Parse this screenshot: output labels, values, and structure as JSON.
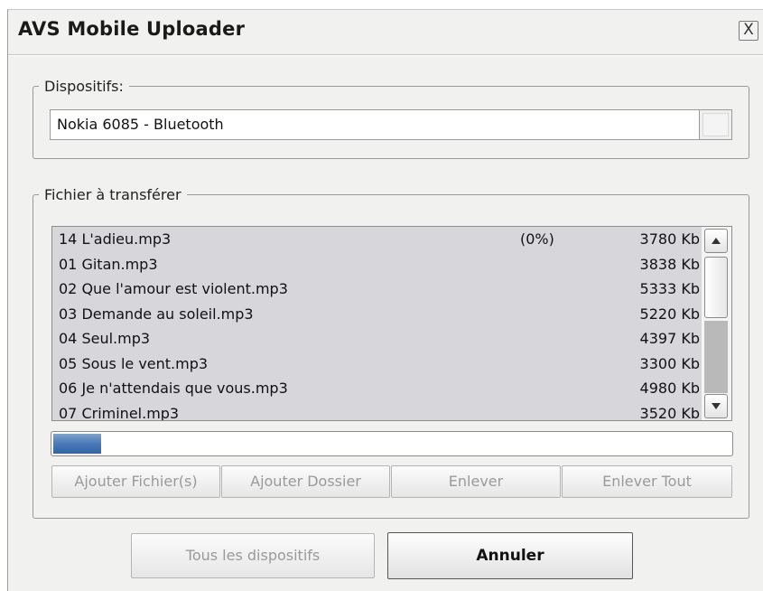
{
  "window": {
    "title": "AVS Mobile Uploader",
    "close_label": "X"
  },
  "devices": {
    "legend": "Dispositifs:",
    "selected": "Nokia 6085 - Bluetooth"
  },
  "files": {
    "legend": "Fichier à transférer",
    "rows": [
      {
        "name": "14 L'adieu.mp3",
        "pct": "(0%)",
        "size": "3780 Kb"
      },
      {
        "name": "01 Gitan.mp3",
        "pct": "",
        "size": "3838 Kb"
      },
      {
        "name": "02 Que l'amour est violent.mp3",
        "pct": "",
        "size": "5333 Kb"
      },
      {
        "name": "03 Demande au soleil.mp3",
        "pct": "",
        "size": "5220 Kb"
      },
      {
        "name": "04 Seul.mp3",
        "pct": "",
        "size": "4397 Kb"
      },
      {
        "name": "05 Sous le vent.mp3",
        "pct": "",
        "size": "3300 Kb"
      },
      {
        "name": "06 Je n'attendais que vous.mp3",
        "pct": "",
        "size": "4980 Kb"
      },
      {
        "name": "07 Criminel.mp3",
        "pct": "",
        "size": "3520 Kb"
      }
    ]
  },
  "progress": {
    "fraction": 0.07
  },
  "actions": {
    "add_files": "Ajouter Fichier(s)",
    "add_folder": "Ajouter Dossier",
    "remove": "Enlever",
    "remove_all": "Enlever Tout"
  },
  "footer": {
    "all_devices": "Tous les dispositifs",
    "cancel": "Annuler"
  },
  "icons": {
    "scroll_up": "triangle-up-icon",
    "scroll_down": "triangle-down-icon",
    "combo_dropdown": "dropdown-button"
  }
}
